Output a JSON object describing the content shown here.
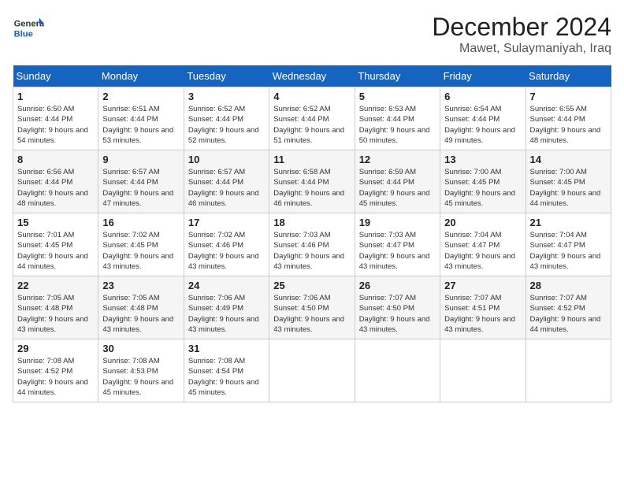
{
  "header": {
    "logo": {
      "text_general": "General",
      "text_blue": "Blue"
    },
    "month_title": "December 2024",
    "location": "Mawet, Sulaymaniyah, Iraq"
  },
  "weekdays": [
    "Sunday",
    "Monday",
    "Tuesday",
    "Wednesday",
    "Thursday",
    "Friday",
    "Saturday"
  ],
  "weeks": [
    [
      {
        "day": 1,
        "sunrise": "6:50 AM",
        "sunset": "4:44 PM",
        "daylight": "9 hours and 54 minutes."
      },
      {
        "day": 2,
        "sunrise": "6:51 AM",
        "sunset": "4:44 PM",
        "daylight": "9 hours and 53 minutes."
      },
      {
        "day": 3,
        "sunrise": "6:52 AM",
        "sunset": "4:44 PM",
        "daylight": "9 hours and 52 minutes."
      },
      {
        "day": 4,
        "sunrise": "6:52 AM",
        "sunset": "4:44 PM",
        "daylight": "9 hours and 51 minutes."
      },
      {
        "day": 5,
        "sunrise": "6:53 AM",
        "sunset": "4:44 PM",
        "daylight": "9 hours and 50 minutes."
      },
      {
        "day": 6,
        "sunrise": "6:54 AM",
        "sunset": "4:44 PM",
        "daylight": "9 hours and 49 minutes."
      },
      {
        "day": 7,
        "sunrise": "6:55 AM",
        "sunset": "4:44 PM",
        "daylight": "9 hours and 48 minutes."
      }
    ],
    [
      {
        "day": 8,
        "sunrise": "6:56 AM",
        "sunset": "4:44 PM",
        "daylight": "9 hours and 48 minutes."
      },
      {
        "day": 9,
        "sunrise": "6:57 AM",
        "sunset": "4:44 PM",
        "daylight": "9 hours and 47 minutes."
      },
      {
        "day": 10,
        "sunrise": "6:57 AM",
        "sunset": "4:44 PM",
        "daylight": "9 hours and 46 minutes."
      },
      {
        "day": 11,
        "sunrise": "6:58 AM",
        "sunset": "4:44 PM",
        "daylight": "9 hours and 46 minutes."
      },
      {
        "day": 12,
        "sunrise": "6:59 AM",
        "sunset": "4:44 PM",
        "daylight": "9 hours and 45 minutes."
      },
      {
        "day": 13,
        "sunrise": "7:00 AM",
        "sunset": "4:45 PM",
        "daylight": "9 hours and 45 minutes."
      },
      {
        "day": 14,
        "sunrise": "7:00 AM",
        "sunset": "4:45 PM",
        "daylight": "9 hours and 44 minutes."
      }
    ],
    [
      {
        "day": 15,
        "sunrise": "7:01 AM",
        "sunset": "4:45 PM",
        "daylight": "9 hours and 44 minutes."
      },
      {
        "day": 16,
        "sunrise": "7:02 AM",
        "sunset": "4:45 PM",
        "daylight": "9 hours and 43 minutes."
      },
      {
        "day": 17,
        "sunrise": "7:02 AM",
        "sunset": "4:46 PM",
        "daylight": "9 hours and 43 minutes."
      },
      {
        "day": 18,
        "sunrise": "7:03 AM",
        "sunset": "4:46 PM",
        "daylight": "9 hours and 43 minutes."
      },
      {
        "day": 19,
        "sunrise": "7:03 AM",
        "sunset": "4:47 PM",
        "daylight": "9 hours and 43 minutes."
      },
      {
        "day": 20,
        "sunrise": "7:04 AM",
        "sunset": "4:47 PM",
        "daylight": "9 hours and 43 minutes."
      },
      {
        "day": 21,
        "sunrise": "7:04 AM",
        "sunset": "4:47 PM",
        "daylight": "9 hours and 43 minutes."
      }
    ],
    [
      {
        "day": 22,
        "sunrise": "7:05 AM",
        "sunset": "4:48 PM",
        "daylight": "9 hours and 43 minutes."
      },
      {
        "day": 23,
        "sunrise": "7:05 AM",
        "sunset": "4:48 PM",
        "daylight": "9 hours and 43 minutes."
      },
      {
        "day": 24,
        "sunrise": "7:06 AM",
        "sunset": "4:49 PM",
        "daylight": "9 hours and 43 minutes."
      },
      {
        "day": 25,
        "sunrise": "7:06 AM",
        "sunset": "4:50 PM",
        "daylight": "9 hours and 43 minutes."
      },
      {
        "day": 26,
        "sunrise": "7:07 AM",
        "sunset": "4:50 PM",
        "daylight": "9 hours and 43 minutes."
      },
      {
        "day": 27,
        "sunrise": "7:07 AM",
        "sunset": "4:51 PM",
        "daylight": "9 hours and 43 minutes."
      },
      {
        "day": 28,
        "sunrise": "7:07 AM",
        "sunset": "4:52 PM",
        "daylight": "9 hours and 44 minutes."
      }
    ],
    [
      {
        "day": 29,
        "sunrise": "7:08 AM",
        "sunset": "4:52 PM",
        "daylight": "9 hours and 44 minutes."
      },
      {
        "day": 30,
        "sunrise": "7:08 AM",
        "sunset": "4:53 PM",
        "daylight": "9 hours and 45 minutes."
      },
      {
        "day": 31,
        "sunrise": "7:08 AM",
        "sunset": "4:54 PM",
        "daylight": "9 hours and 45 minutes."
      },
      null,
      null,
      null,
      null
    ]
  ]
}
